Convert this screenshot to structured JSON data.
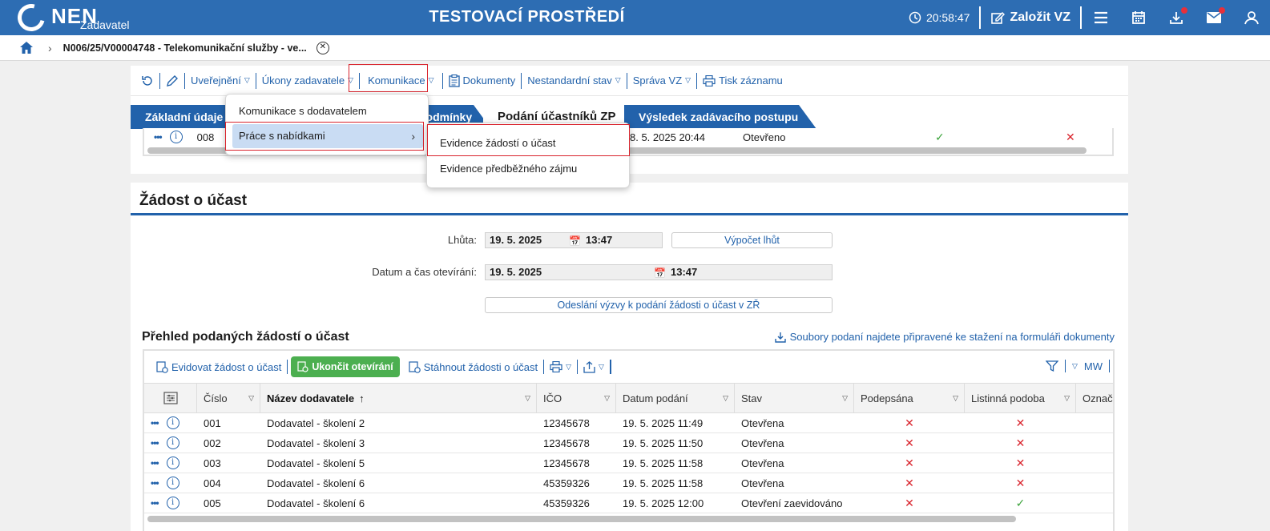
{
  "topbar": {
    "logo_text": "NEN",
    "logo_sub": "Zadavatel",
    "env_title": "TESTOVACÍ PROSTŘEDÍ",
    "clock": "20:58:47",
    "create_label": "Založit VZ",
    "accent": "#2d6db3"
  },
  "breadcrumb": {
    "title": "N006/25/V00004748 - Telekomunikační služby - ve..."
  },
  "toolbar": {
    "items": [
      "Uveřejnění",
      "Úkony zadavatele",
      "Komunikace",
      "Dokumenty",
      "Nestandardní stav",
      "Správa VZ",
      "Tisk záznamu"
    ]
  },
  "tabs": [
    "Základní údaje",
    "podmínky",
    "Podání účastníků ZP",
    "Výsledek zadávacího postupu"
  ],
  "strip_row": {
    "number": "008",
    "date": "8. 5. 2025 20:44",
    "state": "Otevřeno"
  },
  "menu": {
    "items": [
      "Komunikace s dodavatelem",
      "Práce s nabídkami"
    ],
    "submenu": [
      "Evidence žádostí o účast",
      "Evidence předběžného zájmu"
    ]
  },
  "section": {
    "title": "Žádost o účast",
    "deadline_label": "Lhůta:",
    "deadline_date": "19. 5. 2025",
    "deadline_time": "13:47",
    "calc_button": "Výpočet lhůt",
    "opening_label": "Datum a čas otevírání:",
    "opening_date": "19. 5. 2025",
    "opening_time": "13:47",
    "send_button": "Odeslání výzvy k podání žádosti o účast v ZŘ",
    "overview_title": "Přehled podaných žádostí o účast",
    "download_link": "Soubory podaní najdete připravené ke stažení na formuláři dokumenty"
  },
  "grid": {
    "toolbar": {
      "evidovat": "Evidovat žádost o účast",
      "ukoncit": "Ukončit otevírání",
      "stahnout": "Stáhnout žádosti o účast",
      "mw": "MW"
    },
    "columns": [
      "Číslo",
      "Název dodavatele",
      "IČO",
      "Datum podání",
      "Stav",
      "Podepsána",
      "Listinná podoba",
      "Označe"
    ],
    "rows": [
      {
        "num": "001",
        "name": "Dodavatel - školení 2",
        "ico": "12345678",
        "date": "19. 5. 2025 11:49",
        "state": "Otevřena",
        "signed": "x",
        "paper": "x"
      },
      {
        "num": "002",
        "name": "Dodavatel - školení 3",
        "ico": "12345678",
        "date": "19. 5. 2025 11:50",
        "state": "Otevřena",
        "signed": "x",
        "paper": "x"
      },
      {
        "num": "003",
        "name": "Dodavatel - školení 5",
        "ico": "12345678",
        "date": "19. 5. 2025 11:58",
        "state": "Otevřena",
        "signed": "x",
        "paper": "x"
      },
      {
        "num": "004",
        "name": "Dodavatel - školení 6",
        "ico": "45359326",
        "date": "19. 5. 2025 11:58",
        "state": "Otevřena",
        "signed": "x",
        "paper": "x"
      },
      {
        "num": "005",
        "name": "Dodavatel - školení 6",
        "ico": "45359326",
        "date": "19. 5. 2025 12:00",
        "state": "Otevření zaevidováno",
        "signed": "x",
        "paper": "check"
      }
    ]
  }
}
